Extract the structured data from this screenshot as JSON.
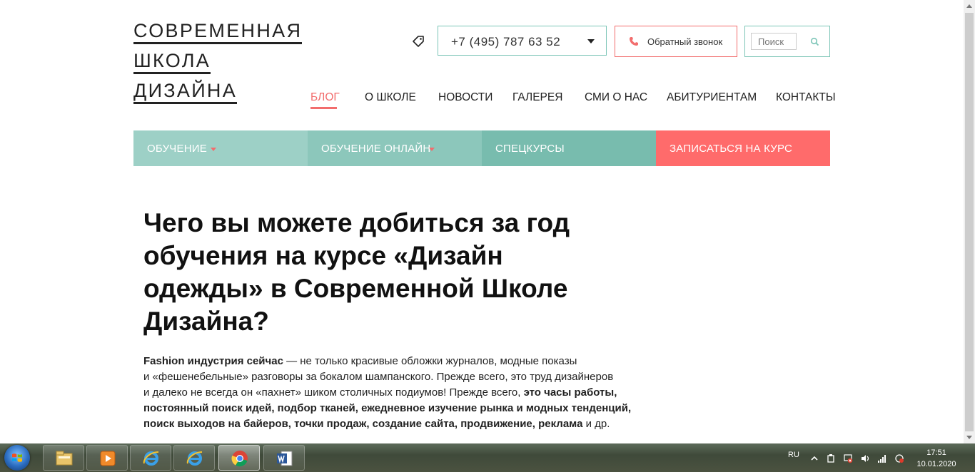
{
  "logo": {
    "lines": [
      "СОВРЕМЕННАЯ",
      "ШКОЛА",
      "ДИЗАЙНА"
    ]
  },
  "header": {
    "phone": "+7 (495) 787 63 52",
    "callback_label": "Обратный звонок",
    "search_placeholder": "Поиск"
  },
  "nav": {
    "items": [
      "БЛОГ",
      "О ШКОЛЕ",
      "НОВОСТИ",
      "ГАЛЕРЕЯ",
      "СМИ О НАС",
      "АБИТУРИЕНТАМ",
      "КОНТАКТЫ"
    ],
    "active": "БЛОГ"
  },
  "menu": {
    "items": [
      "ОБУЧЕНИЕ",
      "ОБУЧЕНИЕ ОНЛАЙН",
      "СПЕЦКУРСЫ",
      "ЗАПИСАТЬСЯ НА КУРС"
    ],
    "colors": [
      "#9dd0c6",
      "#8cc7bb",
      "#78bcae",
      "#ff6b6b"
    ]
  },
  "article": {
    "title": "Чего вы можете добиться за год обучения на курсе «Дизайн одежды» в Современной Школе Дизайна?",
    "p1_bold": "Fashion индустрия сейчас",
    "p1_l1": " — не только красивые обложки журналов, модные показы",
    "p1_l2": "и «фешенебельные» разговоры за бокалом шампанского. Прежде всего, это труд дизайнеров",
    "p1_l3": "и далеко не всегда он «пахнет» шиком столичных подиумов! Прежде всего, ",
    "p1_l3_bold": "это часы работы,",
    "p1_l4_bold": "постоянный поиск идей, подбор тканей, ежедневное изучение рынка и модных тенденций,",
    "p1_l5_bold": "поиск выходов на байеров, точки продаж, создание сайта, продвижение, реклама",
    "p1_l5_tail": " и др."
  },
  "taskbar": {
    "lang": "RU",
    "time": "17:51",
    "date": "10.01.2020"
  },
  "colors": {
    "accent_red": "#f26d6d",
    "accent_teal": "#7cc5b7"
  }
}
